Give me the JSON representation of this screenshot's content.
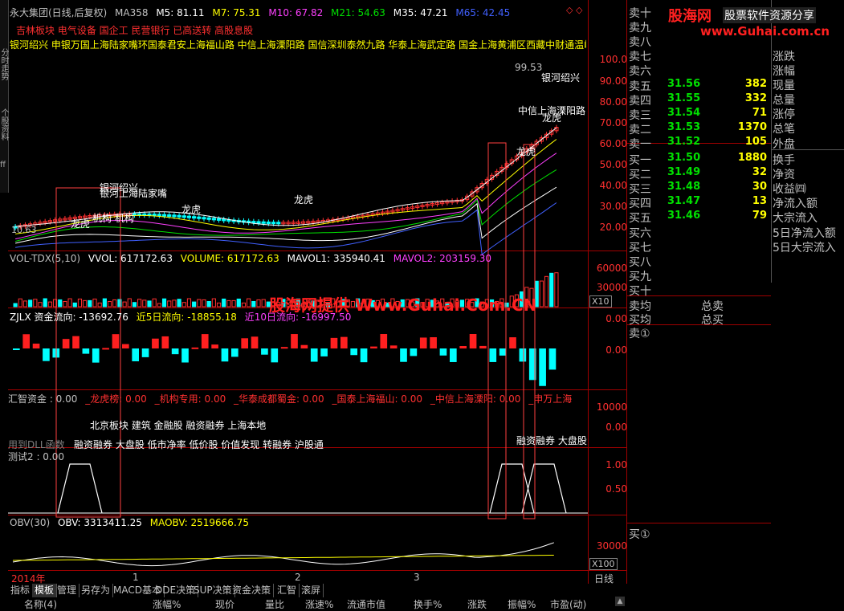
{
  "header": {
    "stock": "永大集团(日线,后复权)",
    "ma_label": "MA358",
    "m5": "M5: 81.11",
    "m7": "M7: 75.31",
    "m10": "M10: 67.82",
    "m21": "M21: 54.63",
    "m35": "M35: 47.21",
    "m65": "M65: 42.45",
    "corner_icons": "◇ ◇"
  },
  "concepts": {
    "line1": "吉林板块 电气设备 国企工 民营银行 已高送转 高股息股",
    "line2": "银河绍兴 申银万国上海陆家嘴环国泰君安上海福山路 中信上海溧阳路 国信深圳泰然九路 华泰上海武定路 国金上海黄浦区西藏中财通温岭"
  },
  "price_chart": {
    "scale": [
      "100.0",
      "90.00",
      "80.00",
      "70.00",
      "60.00",
      "50.00",
      "40.00",
      "30.00",
      "20.00"
    ],
    "high_label": "99.53",
    "low_label": "10.63",
    "annotations": [
      "银河绍兴",
      "中信上海溧阳路",
      "龙虎",
      "龙虎",
      "银河绍兴",
      "银河上海陆家嘴",
      "龙虎",
      "龙虎",
      "机构",
      "机构",
      "龙虎"
    ]
  },
  "volume": {
    "legend": {
      "name": "VOL-TDX(5,10)",
      "vvol": "VVOL: 617172.63",
      "volume": "VOLUME: 617172.63",
      "mavol1": "MAVOL1: 335940.41",
      "mavol2": "MAVOL2: 203159.30"
    },
    "scale": [
      "60000",
      "30000"
    ],
    "unit": "X10",
    "watermark": "股海网提供 Www.Guhai.Com.CN"
  },
  "zjlx": {
    "legend": {
      "name": "ZJLX 资金流向: -13692.76",
      "five": "近5日流向: -18855.18",
      "ten": "近10日流向: -16997.50"
    },
    "scale": [
      "0.00",
      "0.00"
    ]
  },
  "huizhi": {
    "legend": {
      "name": "汇智资金 : 0.00",
      "a": "_龙虎榜: 0.00",
      "b": "_机构专用: 0.00",
      "c": "_华泰成都蜀金: 0.00",
      "d": "_国泰上海福山: 0.00",
      "e": "_中信上海溧阳: 0.00",
      "f": "_申万上海"
    },
    "scale": [
      "10000",
      "0.00"
    ],
    "note": "用到DLL函数",
    "text_row1": "北京板块 建筑 金融股 融资融券 上海本地",
    "text_row2": "融资融券 大盘股 低市净率 低价股 价值发现 转融券 沪股通",
    "text_right": "融资融券 大盘股"
  },
  "test2": {
    "legend": "测试2 : 0.00",
    "scale": [
      "1.00",
      "0.50"
    ]
  },
  "obv": {
    "legend": {
      "name": "OBV(30)",
      "obv": "OBV: 3313411.25",
      "maobv": "MAOBV: 2519666.75"
    },
    "scale": [
      "30000"
    ],
    "unit": "X100"
  },
  "timeline": {
    "year": "2014年",
    "marks": [
      "1",
      "2",
      "3"
    ],
    "period": "日线"
  },
  "tabs": [
    "指标",
    "模板",
    "管理",
    "另存为",
    "MACD基本",
    "DDE决策",
    "SUP决策",
    "资金决策",
    "汇智",
    "滚屏"
  ],
  "active_tab": "模板",
  "columns": [
    "名称(4)",
    "涨幅%",
    "现价",
    "量比",
    "涨速%",
    "流通市值",
    "换手%",
    "涨跌",
    "振幅%",
    "市盈(动)"
  ],
  "orderbook": {
    "sells_empty": [
      "卖十",
      "卖九",
      "卖八",
      "卖七",
      "卖六"
    ],
    "sells": [
      {
        "label": "卖五",
        "price": "31.56",
        "vol": "382"
      },
      {
        "label": "卖四",
        "price": "31.55",
        "vol": "332"
      },
      {
        "label": "卖三",
        "price": "31.54",
        "vol": "71"
      },
      {
        "label": "卖二",
        "price": "31.53",
        "vol": "1370"
      },
      {
        "label": "卖一",
        "price": "31.52",
        "vol": "105"
      }
    ],
    "buys": [
      {
        "label": "买一",
        "price": "31.50",
        "vol": "1880"
      },
      {
        "label": "买二",
        "price": "31.49",
        "vol": "32"
      },
      {
        "label": "买三",
        "price": "31.48",
        "vol": "30"
      },
      {
        "label": "买四",
        "price": "31.47",
        "vol": "13"
      },
      {
        "label": "买五",
        "price": "31.46",
        "vol": "79"
      }
    ],
    "buys_empty": [
      "买六",
      "买七",
      "买八",
      "买九",
      "买十"
    ],
    "avg_sell": "卖均",
    "total_sell": "总卖",
    "avg_buy": "买均",
    "total_buy": "总买",
    "sell_q": "卖①",
    "buy_q": "买①"
  },
  "stats": {
    "top": [
      "涨跌",
      "涨幅",
      "现量",
      "总量",
      "涨停",
      "总笔",
      "外盘"
    ],
    "mid": [
      "换手",
      "净资",
      "收益㈣",
      "净流入额",
      "大宗流入",
      "5日净流入额",
      "5日大宗流入"
    ]
  },
  "logo": {
    "brand": "股海网",
    "slogan": "股票软件资源分享",
    "url": "www.Guhai.com.cn"
  },
  "left_vertical": [
    "分时走势",
    "个股资料",
    "ff"
  ]
}
